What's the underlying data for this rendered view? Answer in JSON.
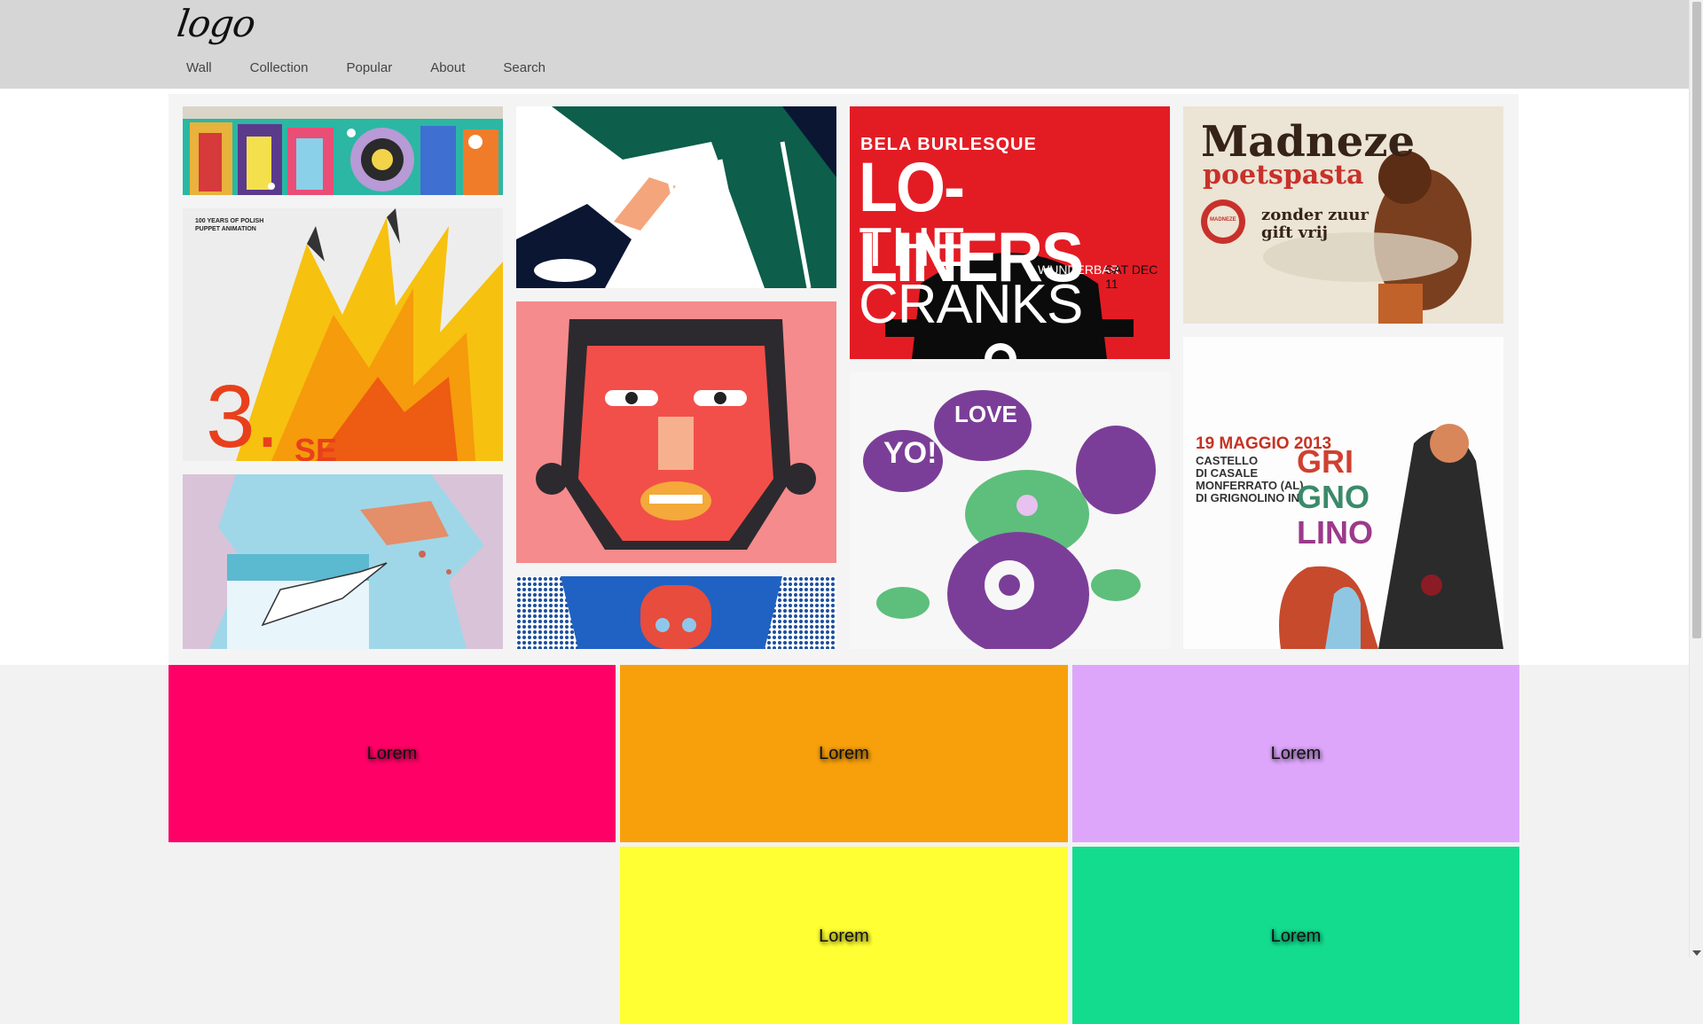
{
  "header": {
    "logo": "logo",
    "nav": [
      "Wall",
      "Collection",
      "Popular",
      "About",
      "Search"
    ]
  },
  "gallery": {
    "loliners": {
      "line1": "BELA BURLESQUE",
      "line2": "LO-LINERS",
      "line3": "THE CRANKS",
      "line4": "WUNDERBAR",
      "line5": "SAT DEC 11"
    },
    "madneze": {
      "line1": "Madneze",
      "line2": "poetspasta",
      "line3": "zonder zuur",
      "line4": "gift vrij",
      "badge": "MADNEZE"
    },
    "polish": {
      "header": "100 YEARS OF POLISH\nPUPPET ANIMATION",
      "number": "3.",
      "sub": "SE"
    },
    "grignolino": {
      "date": "19 MAGGIO 2013",
      "place1": "CASTELLO",
      "place2": "DI CASALE",
      "place3": "MONFERRATO (AL)",
      "place4": "DI GRIGNOLINO IN",
      "w1": "GRI",
      "w2": "GNO",
      "w3": "LINO"
    },
    "yo": {
      "text1": "YO!",
      "text2": "LOVE"
    }
  },
  "cards": [
    {
      "label": "Lorem",
      "color": "#ff0066"
    },
    {
      "label": "Lorem",
      "color": "#f8a00c"
    },
    {
      "label": "Lorem",
      "color": "#dda6fb"
    },
    {
      "label": "Lorem",
      "color": "#ffff33"
    },
    {
      "label": "Lorem",
      "color": "#14dc8f"
    }
  ]
}
